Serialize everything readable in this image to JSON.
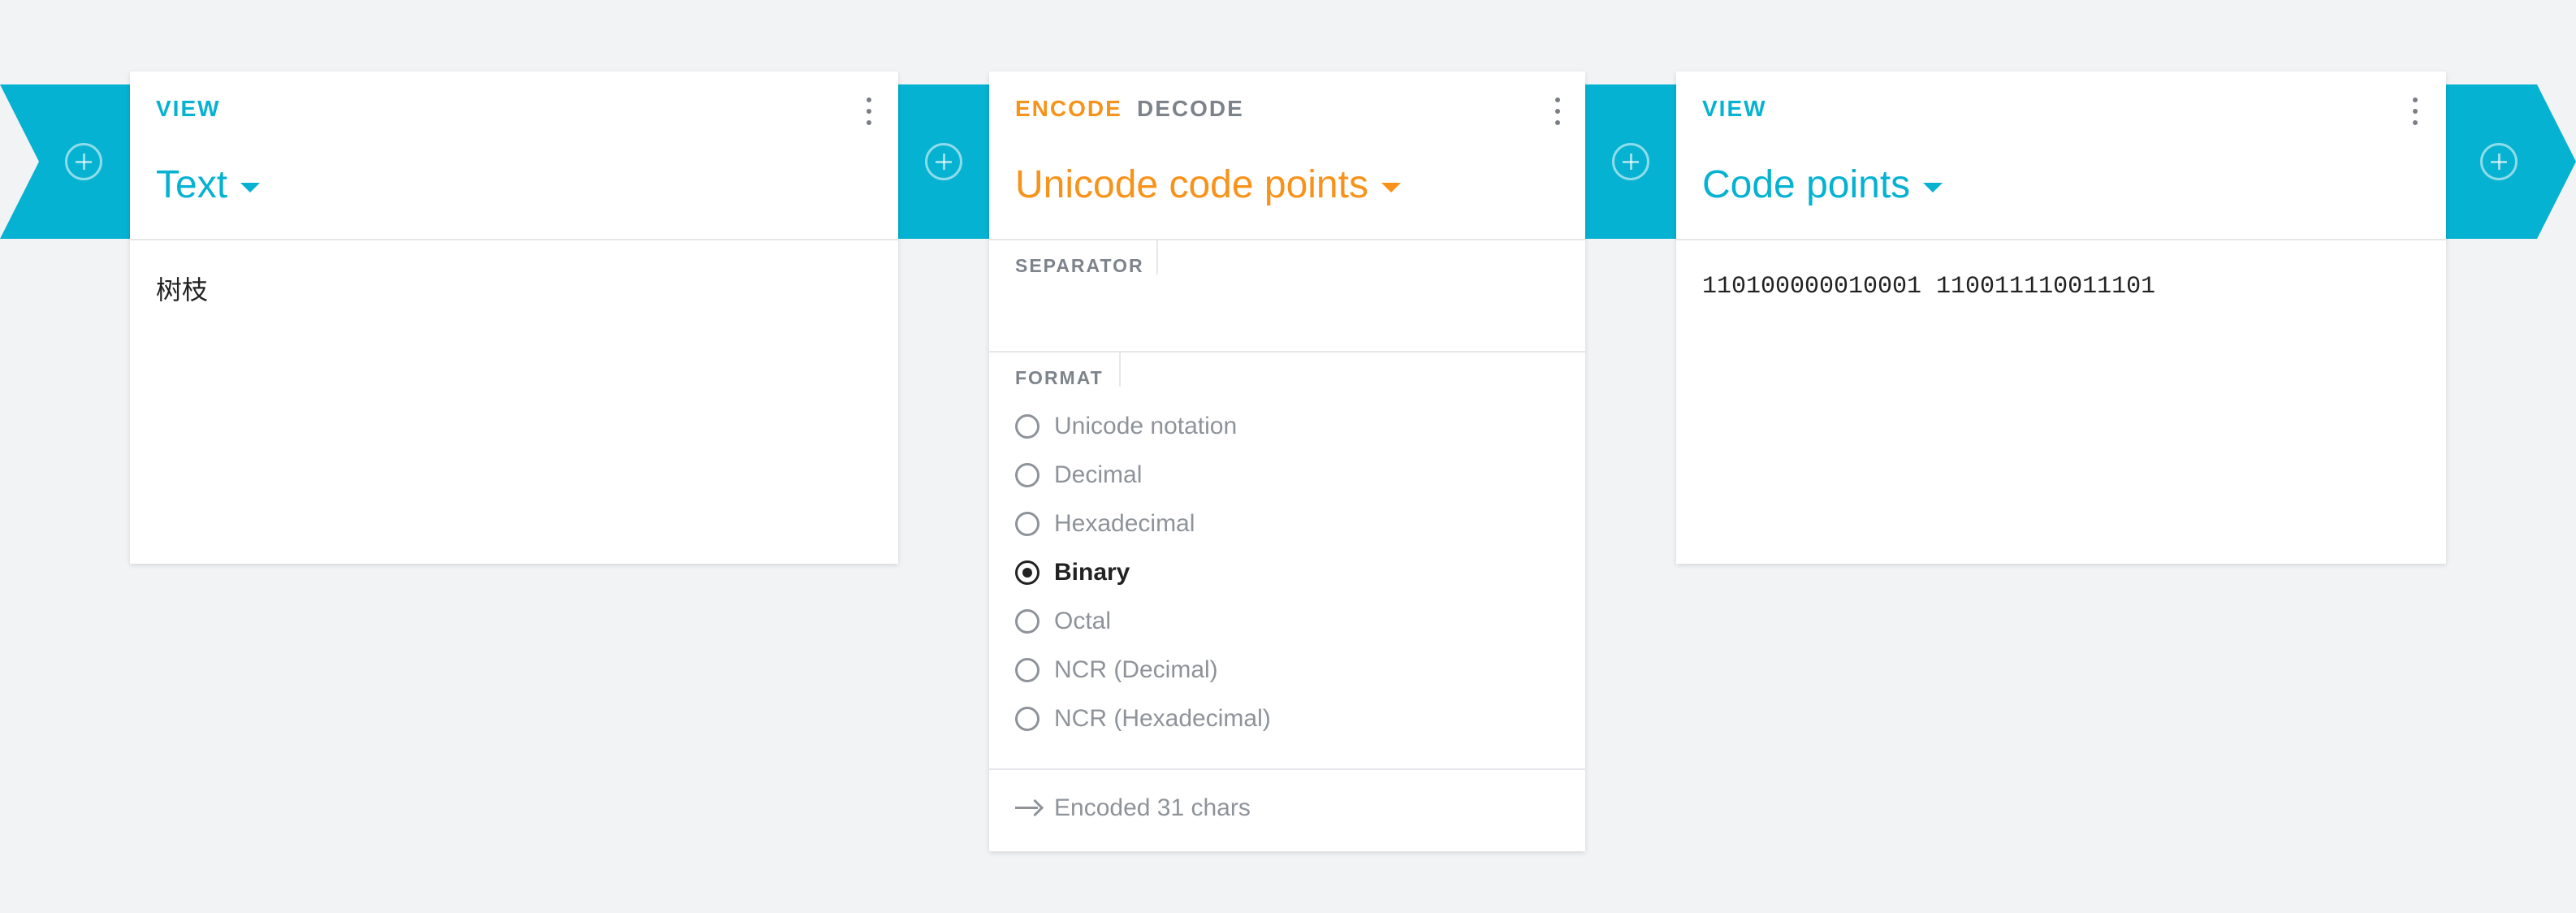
{
  "colors": {
    "teal": "#06b2d1",
    "orange": "#f7931a",
    "muted": "#8e939a"
  },
  "icons": {
    "add": "plus-circle-icon",
    "more": "more-vert-icon",
    "caret": "caret-down-icon",
    "arrow": "arrow-right-icon"
  },
  "card1": {
    "view_label": "VIEW",
    "title": "Text",
    "content": "树枝"
  },
  "card2": {
    "tab_encode": "ENCODE",
    "tab_decode": "DECODE",
    "title": "Unicode code points",
    "separator_label": "SEPARATOR",
    "separator_value": "",
    "format_label": "FORMAT",
    "formats": [
      {
        "label": "Unicode notation",
        "selected": false
      },
      {
        "label": "Decimal",
        "selected": false
      },
      {
        "label": "Hexadecimal",
        "selected": false
      },
      {
        "label": "Binary",
        "selected": true
      },
      {
        "label": "Octal",
        "selected": false
      },
      {
        "label": "NCR (Decimal)",
        "selected": false
      },
      {
        "label": "NCR (Hexadecimal)",
        "selected": false
      }
    ],
    "status": "Encoded 31 chars"
  },
  "card3": {
    "view_label": "VIEW",
    "title": "Code points",
    "content": "110100000010001 110011110011101"
  }
}
